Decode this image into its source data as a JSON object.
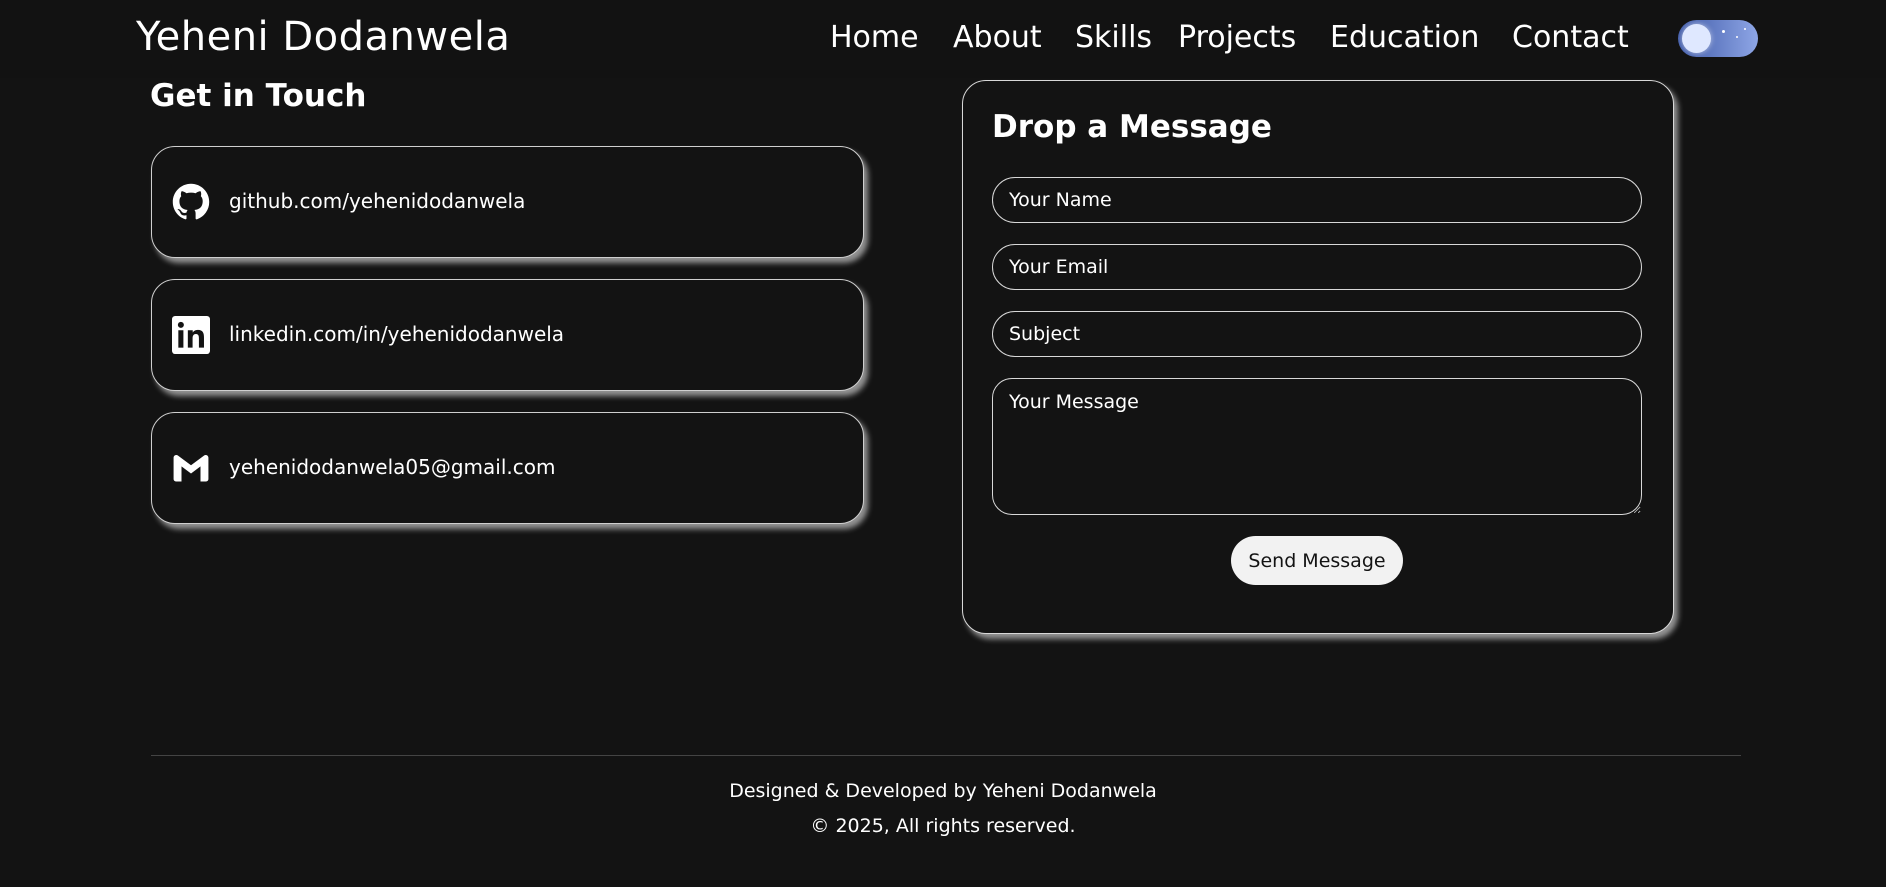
{
  "header": {
    "brand": "Yeheni Dodanwela",
    "nav": [
      {
        "label": "Home"
      },
      {
        "label": "About"
      },
      {
        "label": "Skills"
      },
      {
        "label": "Projects"
      },
      {
        "label": "Education"
      },
      {
        "label": "Contact"
      }
    ],
    "theme_toggle": {
      "state": "dark",
      "icon": "moon-toggle-icon"
    }
  },
  "contact": {
    "title": "Get in Touch",
    "items": [
      {
        "icon": "github-icon",
        "text": "github.com/yehenidodanwela"
      },
      {
        "icon": "linkedin-icon",
        "text": "linkedin.com/in/yehenidodanwela"
      },
      {
        "icon": "gmail-icon",
        "text": "yehenidodanwela05@gmail.com"
      }
    ]
  },
  "form": {
    "title": "Drop a Message",
    "name_placeholder": "Your Name",
    "email_placeholder": "Your Email",
    "subject_placeholder": "Subject",
    "message_placeholder": "Your Message",
    "submit_label": "Send Message"
  },
  "footer": {
    "credit": "Designed & Developed by Yeheni Dodanwela",
    "copyright": "© 2025, All rights reserved."
  },
  "colors": {
    "background": "#131313",
    "text": "#ffffff",
    "button_bg": "#f2f2f2",
    "toggle_start": "#3f5aa8",
    "toggle_end": "#8ea6e6"
  }
}
